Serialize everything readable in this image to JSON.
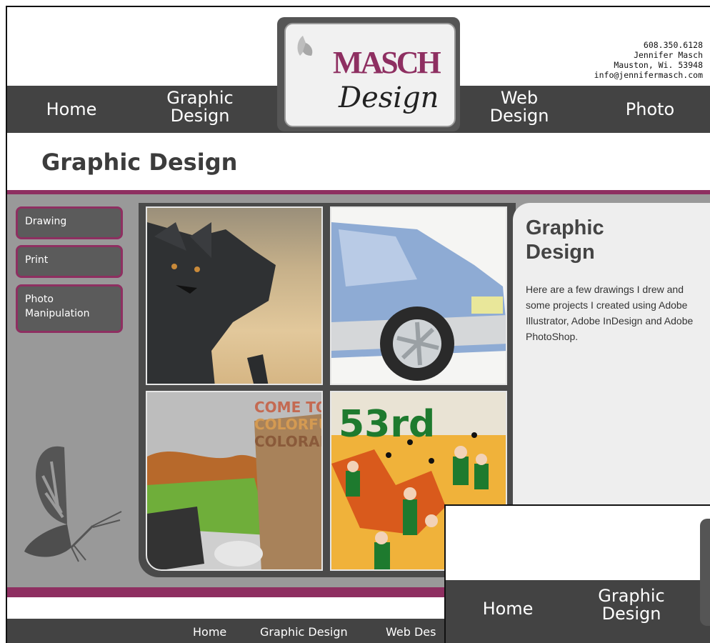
{
  "contact": {
    "phone": "608.350.6128",
    "name": "Jennifer Masch",
    "city": "Mauston, Wi. 53948",
    "email": "info@jennifermasch.com"
  },
  "logo": {
    "line1": "MASCH",
    "line2": "Design"
  },
  "nav": {
    "home": "Home",
    "graphic_1": "Graphic",
    "graphic_2": "Design",
    "web_1": "Web",
    "web_2": "Design",
    "photo": "Photo"
  },
  "page_title": "Graphic Design",
  "sidebar": [
    "Drawing",
    "Print",
    "Photo",
    "Manipulation"
  ],
  "panel": {
    "heading_1": "Graphic",
    "heading_2": "Design",
    "body": "Here are a few drawings I drew and some projects I created using Adobe Illustrator, Adobe InDesign and Adobe PhotoShop."
  },
  "thumb_text": {
    "colorado_1": "COME TO",
    "colorado_2": "COLORFUL",
    "colorado_3": "COLORAD",
    "fest": "53rd"
  },
  "footer": [
    "Home",
    "Graphic Design",
    "Web Des"
  ],
  "overlay": {
    "home": "Home",
    "graphic_1": "Graphic",
    "graphic_2": "Design"
  },
  "colors": {
    "accent": "#8e2f61",
    "nav": "#434343",
    "content": "#999999"
  }
}
